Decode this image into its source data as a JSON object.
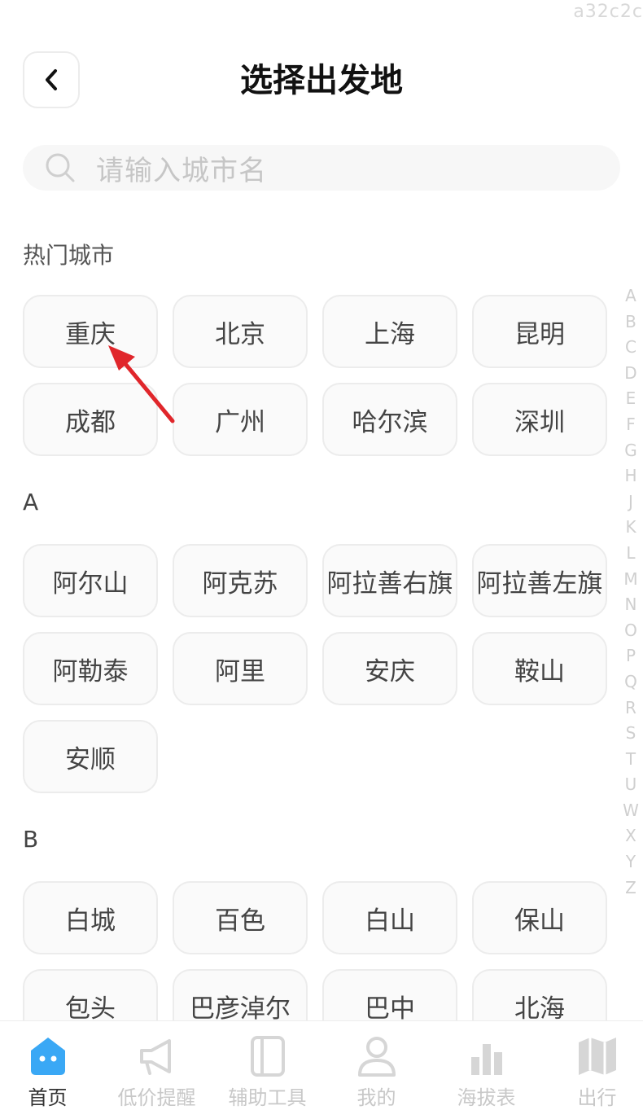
{
  "watermark": "a32c2c",
  "header": {
    "title": "选择出发地"
  },
  "search": {
    "placeholder": "请输入城市名"
  },
  "hot": {
    "title": "热门城市",
    "cities": [
      "重庆",
      "北京",
      "上海",
      "昆明",
      "成都",
      "广州",
      "哈尔滨",
      "深圳"
    ]
  },
  "sections": [
    {
      "letter": "A",
      "cities": [
        "阿尔山",
        "阿克苏",
        "阿拉善右旗",
        "阿拉善左旗",
        "阿勒泰",
        "阿里",
        "安庆",
        "鞍山",
        "安顺"
      ]
    },
    {
      "letter": "B",
      "cities": [
        "白城",
        "百色",
        "白山",
        "保山",
        "包头",
        "巴彦淖尔",
        "巴中",
        "北海"
      ]
    }
  ],
  "index_letters": [
    "A",
    "B",
    "C",
    "D",
    "E",
    "F",
    "G",
    "H",
    "J",
    "K",
    "L",
    "M",
    "N",
    "O",
    "P",
    "Q",
    "R",
    "S",
    "T",
    "U",
    "W",
    "X",
    "Y",
    "Z"
  ],
  "tabs": [
    {
      "label": "首页",
      "icon": "home-icon",
      "active": true
    },
    {
      "label": "低价提醒",
      "icon": "megaphone-icon",
      "active": false
    },
    {
      "label": "辅助工具",
      "icon": "tools-icon",
      "active": false
    },
    {
      "label": "我的",
      "icon": "user-icon",
      "active": false
    },
    {
      "label": "海拔表",
      "icon": "bar-chart-icon",
      "active": false
    },
    {
      "label": "出行",
      "icon": "map-icon",
      "active": false
    }
  ],
  "colors": {
    "accent": "#3aa8f5",
    "arrow": "#e0262b"
  }
}
